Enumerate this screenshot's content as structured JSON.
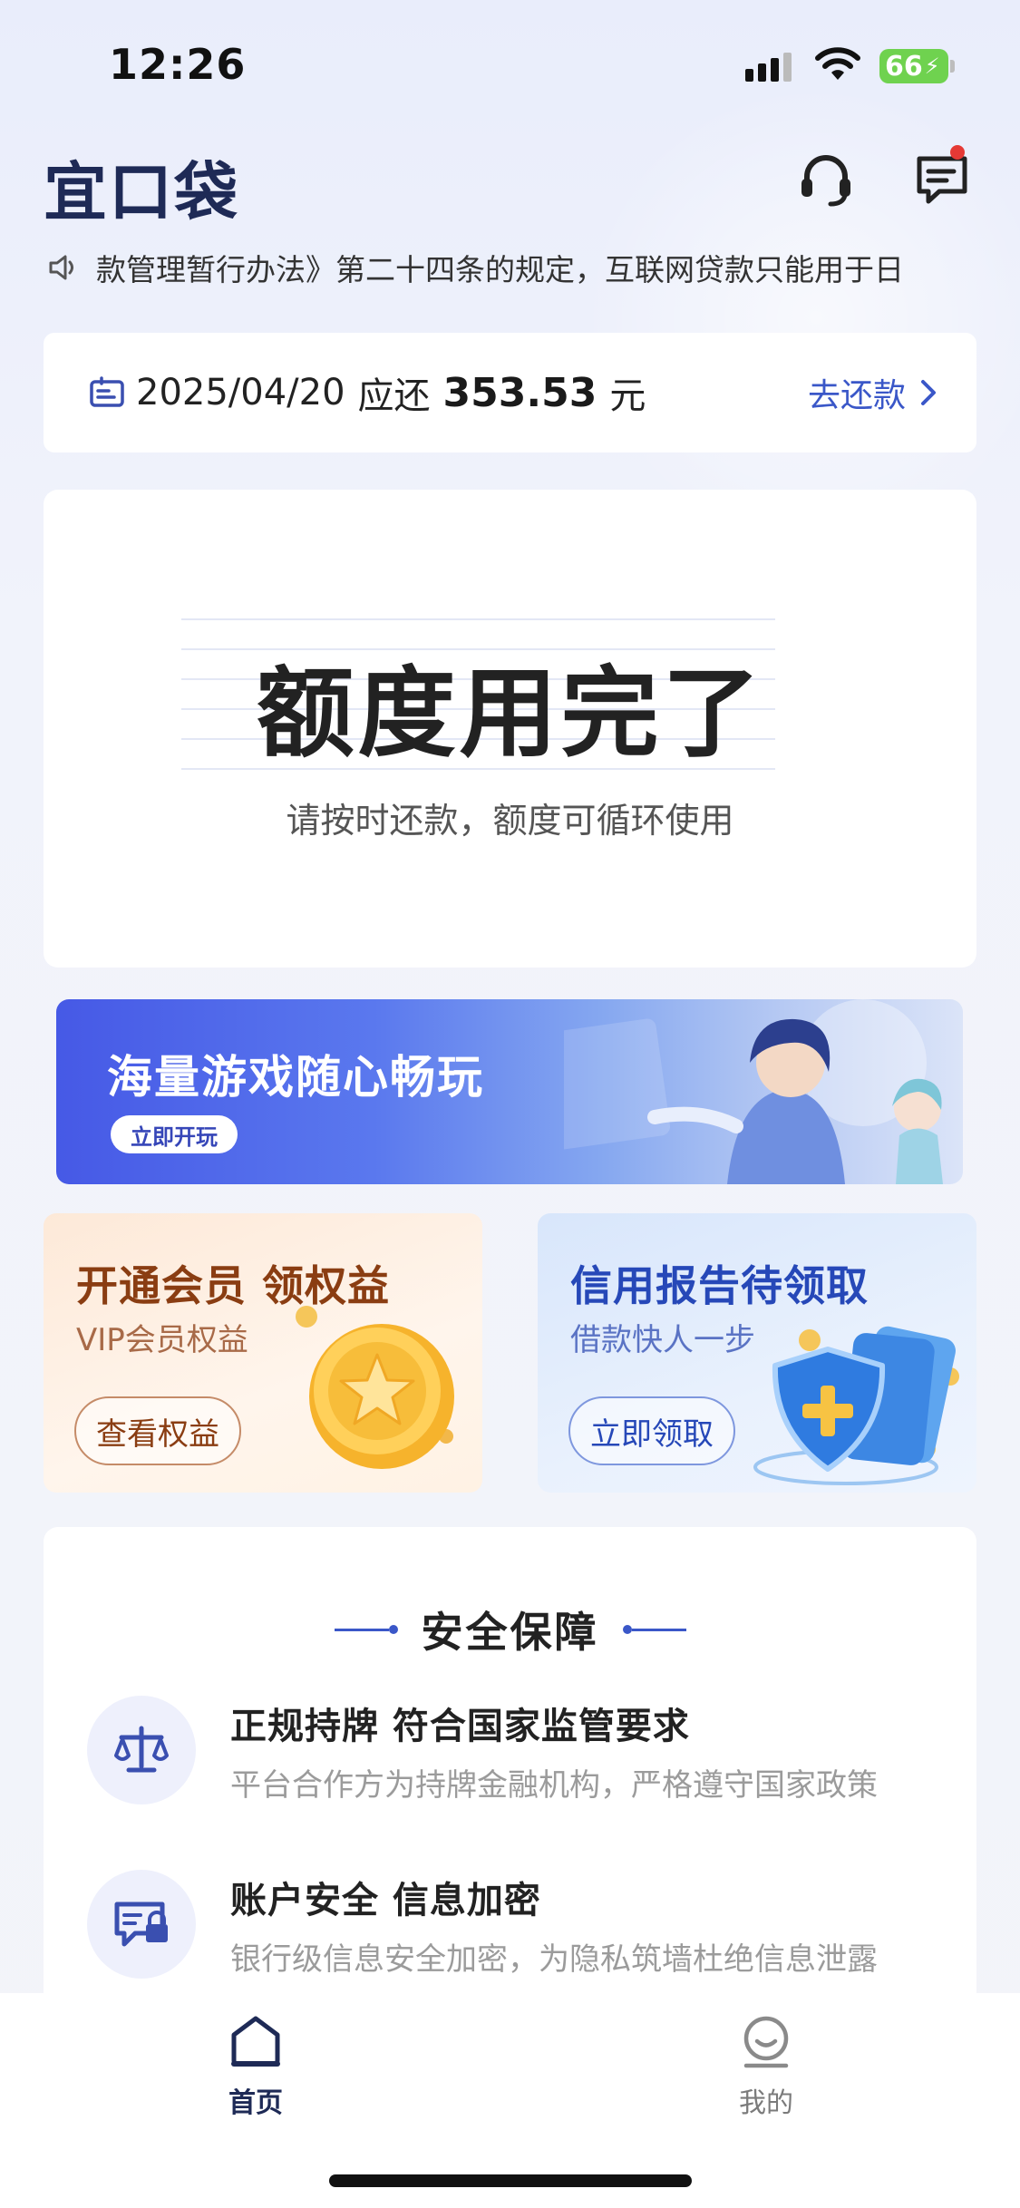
{
  "status_bar": {
    "time": "12:26",
    "battery": "66",
    "icons": [
      "cellular-signal-icon",
      "wifi-icon",
      "battery-charging-icon"
    ]
  },
  "header": {
    "logo": "宜口袋",
    "icons": [
      "headset-support-icon",
      "message-icon"
    ],
    "message_badge_color": "#e53935"
  },
  "notice": {
    "icon": "speaker-icon",
    "text": "款管理暂行办法》第二十四条的规定，互联网贷款只能用于日"
  },
  "repay": {
    "icon": "bill-icon",
    "date": "2025/04/20",
    "due_label": "应还",
    "amount": "353.53",
    "unit": "元",
    "action": "去还款",
    "accent": "#3a57c8"
  },
  "quota": {
    "title": "额度用完了",
    "subtitle": "请按时还款，额度可循环使用"
  },
  "game_banner": {
    "title": "海量游戏随心畅玩",
    "button": "立即开玩"
  },
  "promos": {
    "member": {
      "title": "开通会员 领权益",
      "subtitle": "VIP会员权益",
      "button": "查看权益",
      "icon": "gold-star-coin-icon"
    },
    "credit": {
      "title": "信用报告待领取",
      "subtitle": "借款快人一步",
      "button": "立即领取",
      "icon": "shield-cards-icon"
    }
  },
  "security": {
    "title": "安全保障",
    "items": [
      {
        "icon": "scale-balance-icon",
        "title": "正规持牌 符合国家监管要求",
        "desc": "平台合作方为持牌金融机构，严格遵守国家政策"
      },
      {
        "icon": "lock-card-icon",
        "title": "账户安全 信息加密",
        "desc": "银行级信息安全加密，为隐私筑墙杜绝信息泄露"
      }
    ]
  },
  "tabbar": {
    "tabs": [
      {
        "label": "首页",
        "icon": "home-icon",
        "active": true
      },
      {
        "label": "我的",
        "icon": "profile-icon",
        "active": false
      }
    ]
  }
}
